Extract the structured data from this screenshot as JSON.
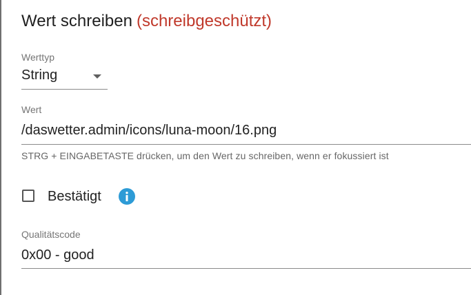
{
  "dialog": {
    "title": "Wert schreiben",
    "readonly_note": "(schreibgeschützt)"
  },
  "value_type": {
    "label": "Werttyp",
    "selected": "String"
  },
  "value": {
    "label": "Wert",
    "current": "/daswetter.admin/icons/luna-moon/16.png",
    "helper_text": "STRG + EINGABETASTE drücken, um den Wert zu schreiben, wenn er fokussiert ist"
  },
  "ack": {
    "label": "Bestätigt",
    "checked": false,
    "info_icon": "info-icon"
  },
  "quality": {
    "label": "Qualitätscode",
    "value": "0x00 - good"
  },
  "colors": {
    "readonly_note": "#c0392b",
    "info_icon": "#2d9bd6"
  }
}
